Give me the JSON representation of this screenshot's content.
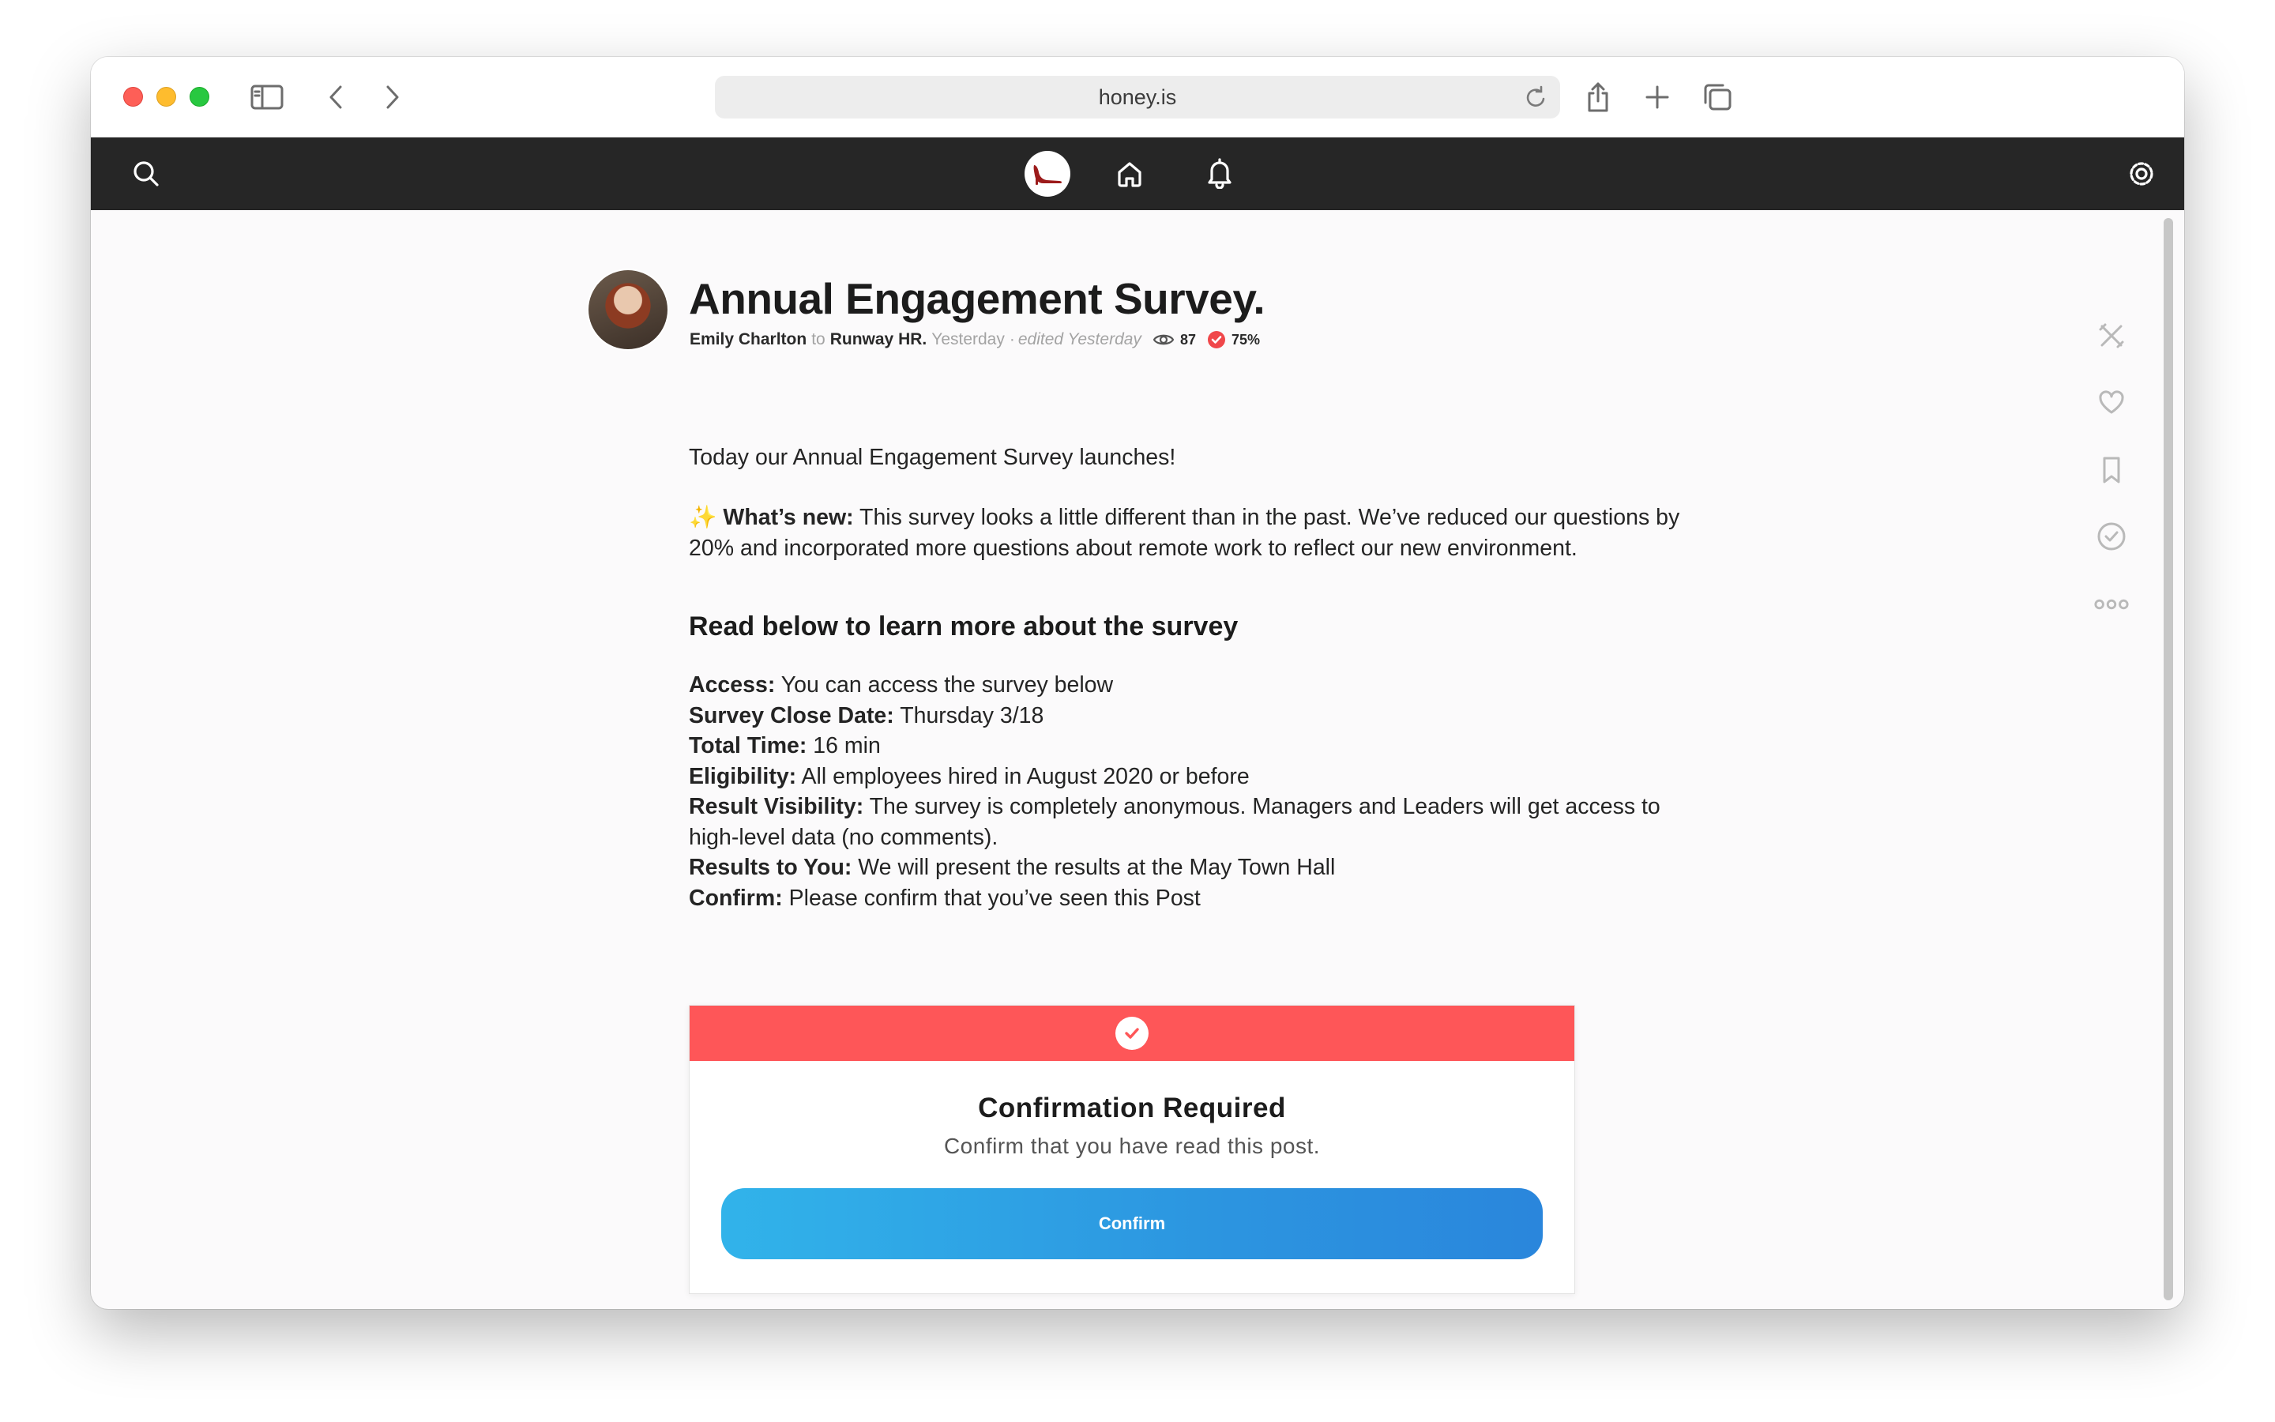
{
  "browser": {
    "url": "honey.is"
  },
  "post": {
    "title": "Annual Engagement Survey.",
    "author": "Emily Charlton",
    "to_word": "to",
    "group": "Runway HR.",
    "posted": "Yesterday",
    "separator": "·",
    "edited": "edited Yesterday",
    "views": "87",
    "confirm_rate": "75%",
    "intro": "Today our Annual Engagement Survey launches!",
    "whats_new_emoji": "✨",
    "whats_new_label": "What’s new:",
    "whats_new_text": "This survey looks a little different than in the past. We’ve reduced our questions by 20% and incorporated more questions about remote work to reflect our new environment.",
    "heading": "Read below to learn more about the survey",
    "details": [
      {
        "label": "Access:",
        "value": "You can access the survey below"
      },
      {
        "label": "Survey Close Date:",
        "value": "Thursday 3/18"
      },
      {
        "label": "Total Time:",
        "value": "16 min"
      },
      {
        "label": "Eligibility:",
        "value": "All employees hired in August 2020 or before"
      },
      {
        "label": "Result Visibility:",
        "value": "The survey is completely anonymous. Managers and Leaders will get access to high-level data (no comments)."
      },
      {
        "label": "Results to You:",
        "value": "We will present the results at the May Town Hall"
      },
      {
        "label": "Confirm:",
        "value": "Please confirm that you’ve seen this Post"
      }
    ]
  },
  "confirmation": {
    "title": "Confirmation Required",
    "subtitle": "Confirm that you have read this post.",
    "button_label": "Confirm",
    "accent_color": "#fe5658"
  },
  "icons": {
    "nav": [
      "search-icon",
      "honey-logo-icon",
      "home-icon",
      "bell-icon",
      "settings-icon"
    ],
    "rail": [
      "close-post-icon",
      "heart-icon",
      "bookmark-icon",
      "check-circle-icon",
      "more-icon"
    ]
  }
}
